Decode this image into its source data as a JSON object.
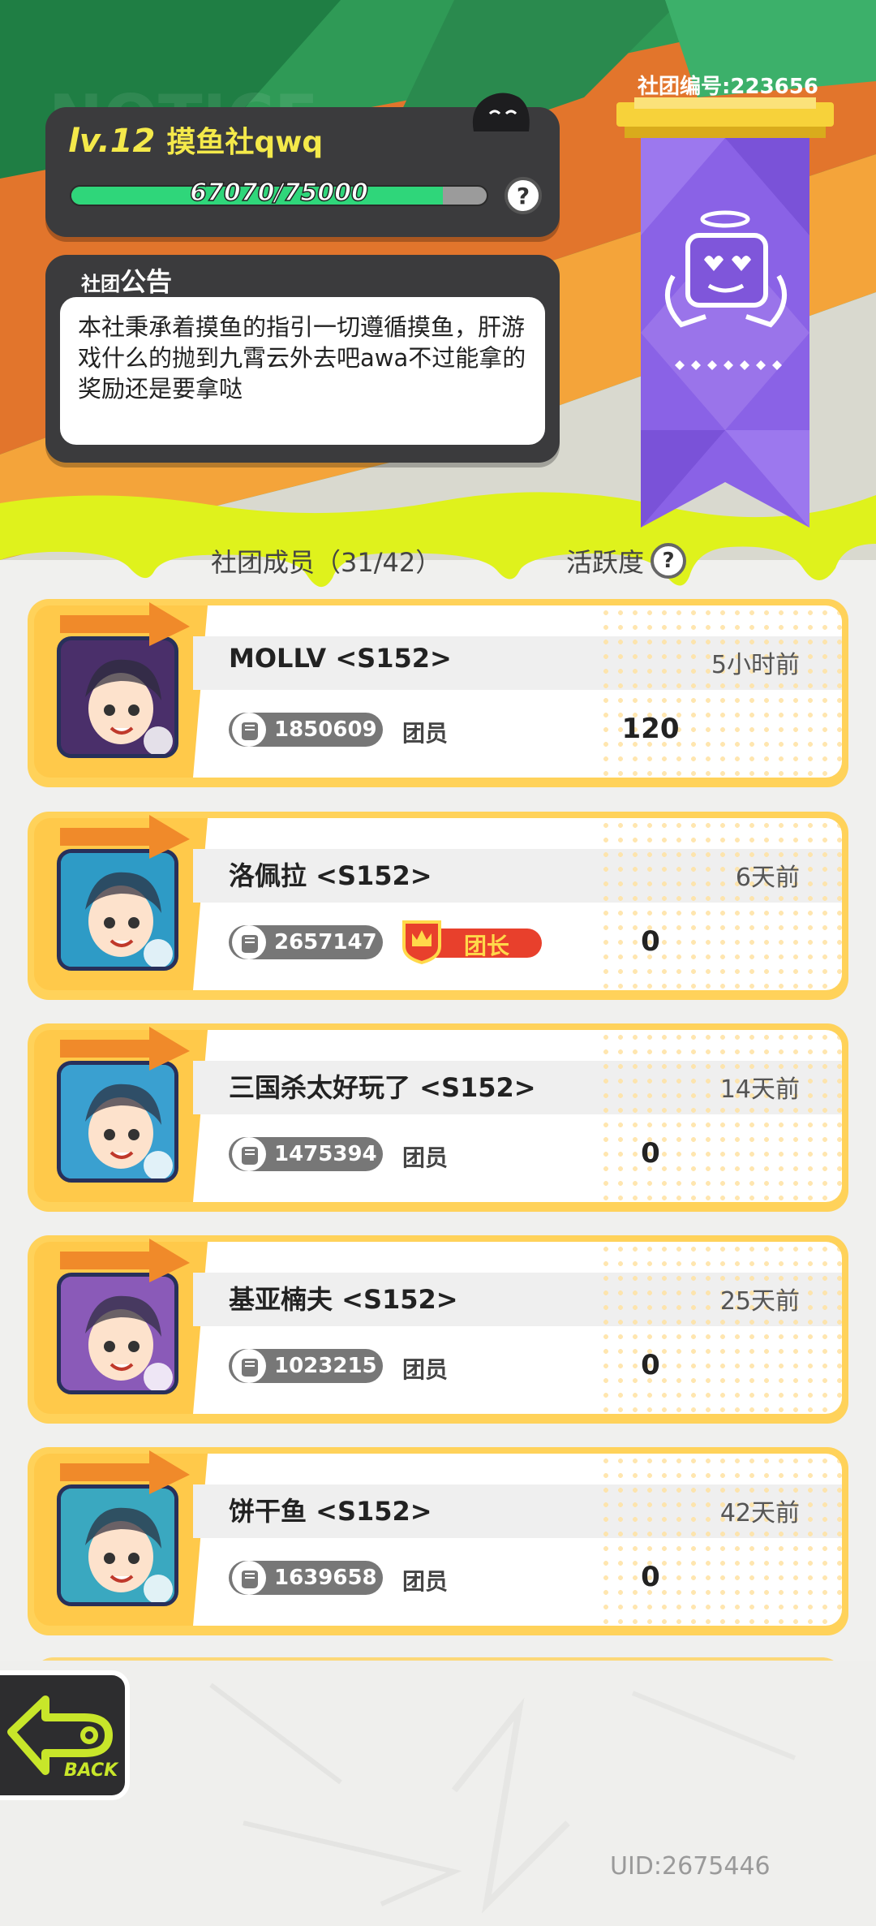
{
  "club": {
    "level": "lv.12",
    "name": "摸鱼社qwq",
    "xp_text": "67070/75000",
    "xp_fraction": 0.894,
    "club_id": "社团编号:223656",
    "announcement_label_small": "社团",
    "announcement_label_big": "公告",
    "announcement": "本社秉承着摸鱼的指引一切遵循摸鱼，肝游戏什么的抛到九霄云外去吧awa不过能拿的奖励还是要拿哒",
    "watermark": "NOTICE"
  },
  "members_header": {
    "members": "社团成员（31/42）",
    "activity": "活跃度"
  },
  "help_symbol": "?",
  "members": [
    {
      "name": "MOLLV <S152>",
      "time": "5小时前",
      "power": "1850609",
      "role": "团员",
      "score": "120",
      "leader": false,
      "avatar_color": "#4a2f6a"
    },
    {
      "name": "洛佩拉 <S152>",
      "time": "6天前",
      "power": "2657147",
      "role": "团长",
      "score": "0",
      "leader": true,
      "avatar_color": "#2e9bc6"
    },
    {
      "name": "三国杀太好玩了 <S152>",
      "time": "14天前",
      "power": "1475394",
      "role": "团员",
      "score": "0",
      "leader": false,
      "avatar_color": "#3aa0d0"
    },
    {
      "name": "基亚楠夫 <S152>",
      "time": "25天前",
      "power": "1023215",
      "role": "团员",
      "score": "0",
      "leader": false,
      "avatar_color": "#8a5ab8"
    },
    {
      "name": "饼干鱼 <S152>",
      "time": "42天前",
      "power": "1639658",
      "role": "团员",
      "score": "0",
      "leader": false,
      "avatar_color": "#3aa8c0"
    }
  ],
  "back": {
    "label": "BACK"
  },
  "uid": "UID:2675446",
  "colors": {
    "accent_green": "#2fd67a",
    "banner_purple": "#8a62e6",
    "card_yellow": "#ffc94a",
    "slime": "#dff21c"
  }
}
